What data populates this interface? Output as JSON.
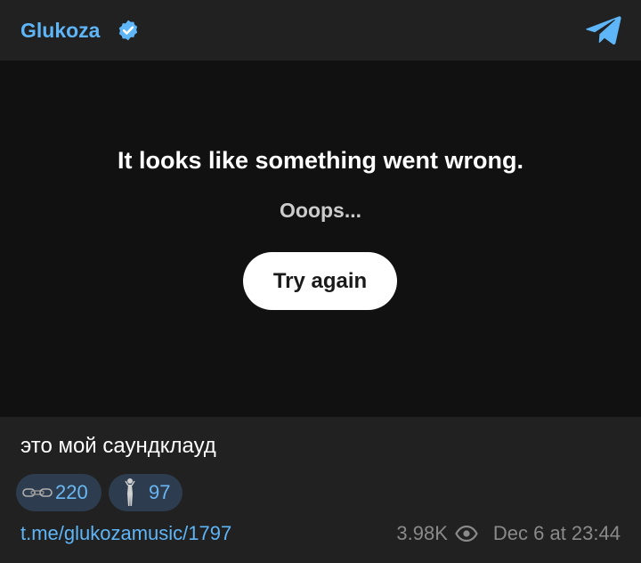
{
  "header": {
    "channel_name": "Glukoza",
    "verified_icon": "verified-badge-icon",
    "telegram_icon": "telegram-plane-icon",
    "accent_color": "#5eb5f7"
  },
  "embed": {
    "error_title": "It looks like something went wrong.",
    "error_subtitle": "Ooops...",
    "retry_label": "Try again"
  },
  "post": {
    "caption": "это мой саундклауд",
    "reactions": [
      {
        "icon": "chain-emoji-icon",
        "count": "220"
      },
      {
        "icon": "figure-emoji-icon",
        "count": "97"
      }
    ],
    "link": "t.me/glukozamusic/1797",
    "views": "3.98K",
    "views_icon": "eye-icon",
    "date": "Dec 6 at 23:44"
  }
}
